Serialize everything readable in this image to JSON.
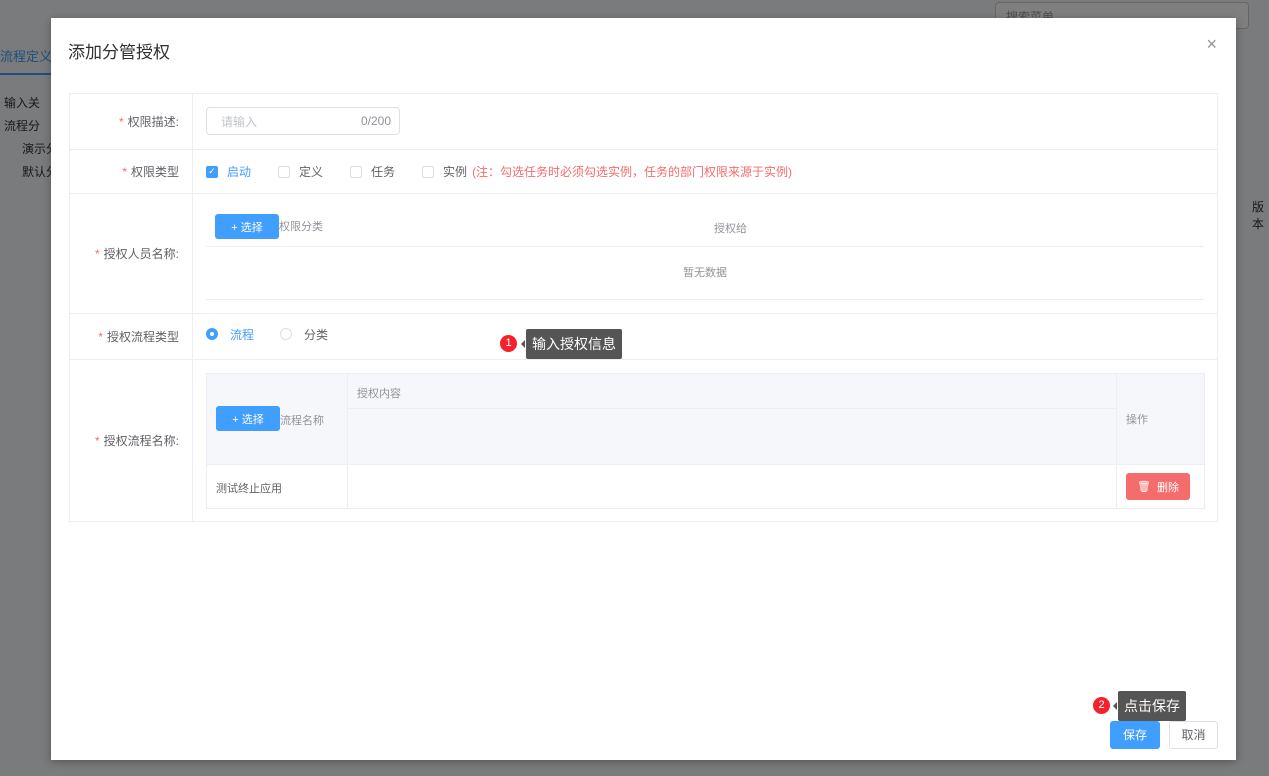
{
  "background": {
    "search_placeholder": "搜索菜单",
    "tab": "流程定义",
    "tree_search": "输入关",
    "tree": [
      "流程分",
      "演示分",
      "默认分"
    ],
    "col": "版本"
  },
  "modal": {
    "title": "添加分管授权",
    "close": "×"
  },
  "form": {
    "desc": {
      "label": "权限描述:",
      "placeholder": "请输入",
      "count": "0/200"
    },
    "type": {
      "label": "权限类型",
      "options": [
        {
          "label": "启动",
          "checked": true
        },
        {
          "label": "定义",
          "checked": false
        },
        {
          "label": "任务",
          "checked": false
        },
        {
          "label": "实例",
          "checked": false
        }
      ],
      "note": "(注：勾选任务时必须勾选实例，任务的部门权限来源于实例)"
    },
    "persons": {
      "label": "授权人员名称:",
      "select": "+ 选择",
      "col1": "权限分类",
      "col2": "授权给",
      "empty": "暂无数据"
    },
    "flow_type": {
      "label": "授权流程类型",
      "options": [
        {
          "label": "流程",
          "selected": true
        },
        {
          "label": "分类",
          "selected": false
        }
      ]
    },
    "flows": {
      "label": "授权流程名称:",
      "select": "+ 选择",
      "col1": "流程名称",
      "col2": "授权内容",
      "col3": "操作",
      "rows": [
        {
          "name": "测试终止应用",
          "content": "",
          "delete": "删除"
        }
      ]
    }
  },
  "tips": [
    {
      "num": "1",
      "text": "输入授权信息"
    },
    {
      "num": "2",
      "text": "点击保存"
    }
  ],
  "footer": {
    "save": "保存",
    "cancel": "取消"
  }
}
